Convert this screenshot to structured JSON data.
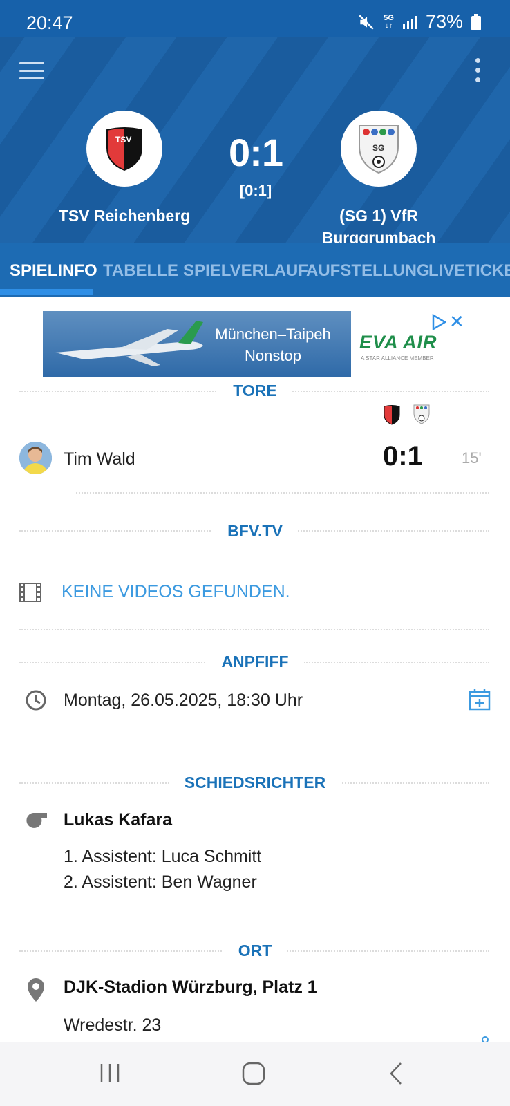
{
  "status": {
    "time": "20:47",
    "network": "5G",
    "battery": "73%"
  },
  "match": {
    "home_team": "TSV Reichenberg",
    "home_crest_text": "TSV",
    "away_team_line1": "(SG 1) VfR",
    "away_team_line2": "Burggrumbach",
    "away_crest_text": "SG",
    "score": "0:1",
    "halftime": "[0:1]"
  },
  "tabs": [
    {
      "label": "SPIELINFO"
    },
    {
      "label": "TABELLE"
    },
    {
      "label": "SPIELVERLAUF"
    },
    {
      "label": "AUFSTELLUNG"
    },
    {
      "label": "LIVETICKER"
    }
  ],
  "ad": {
    "headline_line1": "München–Taipeh",
    "headline_line2": "Nonstop",
    "brand": "EVA AIR",
    "tagline": "A STAR ALLIANCE MEMBER"
  },
  "goals": {
    "title": "TORE",
    "items": [
      {
        "player": "Tim Wald",
        "score": "0:1",
        "minute": "15'"
      }
    ]
  },
  "tv": {
    "title": "BFV.TV",
    "empty_text": "KEINE VIDEOS GEFUNDEN."
  },
  "kickoff": {
    "title": "ANPFIFF",
    "datetime": "Montag, 26.05.2025, 18:30 Uhr"
  },
  "referee": {
    "title": "SCHIEDSRICHTER",
    "name": "Lukas Kafara",
    "assistant1": "1. Assistent: Luca Schmitt",
    "assistant2": "2. Assistent: Ben Wagner"
  },
  "location": {
    "title": "ORT",
    "venue": "DJK-Stadion Würzburg, Platz 1",
    "street": "Wredestr. 23"
  },
  "colors": {
    "header": "#1a5c9e",
    "tabs": "#1d6bb3",
    "accent": "#1a72b8",
    "link": "#3c9ae0"
  }
}
